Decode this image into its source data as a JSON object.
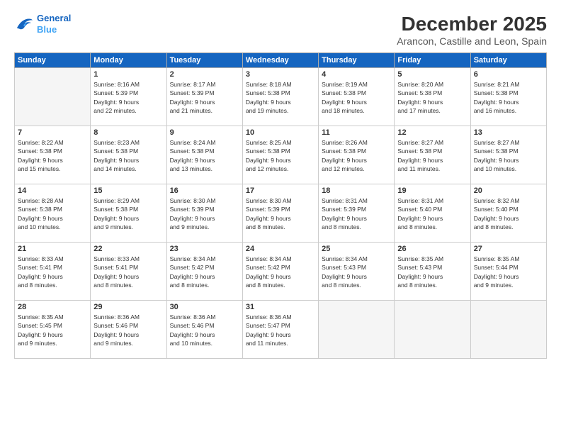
{
  "logo": {
    "line1": "General",
    "line2": "Blue"
  },
  "title": "December 2025",
  "subtitle": "Arancon, Castille and Leon, Spain",
  "days_header": [
    "Sunday",
    "Monday",
    "Tuesday",
    "Wednesday",
    "Thursday",
    "Friday",
    "Saturday"
  ],
  "weeks": [
    [
      {
        "num": "",
        "info": ""
      },
      {
        "num": "1",
        "info": "Sunrise: 8:16 AM\nSunset: 5:39 PM\nDaylight: 9 hours\nand 22 minutes."
      },
      {
        "num": "2",
        "info": "Sunrise: 8:17 AM\nSunset: 5:39 PM\nDaylight: 9 hours\nand 21 minutes."
      },
      {
        "num": "3",
        "info": "Sunrise: 8:18 AM\nSunset: 5:38 PM\nDaylight: 9 hours\nand 19 minutes."
      },
      {
        "num": "4",
        "info": "Sunrise: 8:19 AM\nSunset: 5:38 PM\nDaylight: 9 hours\nand 18 minutes."
      },
      {
        "num": "5",
        "info": "Sunrise: 8:20 AM\nSunset: 5:38 PM\nDaylight: 9 hours\nand 17 minutes."
      },
      {
        "num": "6",
        "info": "Sunrise: 8:21 AM\nSunset: 5:38 PM\nDaylight: 9 hours\nand 16 minutes."
      }
    ],
    [
      {
        "num": "7",
        "info": "Sunrise: 8:22 AM\nSunset: 5:38 PM\nDaylight: 9 hours\nand 15 minutes."
      },
      {
        "num": "8",
        "info": "Sunrise: 8:23 AM\nSunset: 5:38 PM\nDaylight: 9 hours\nand 14 minutes."
      },
      {
        "num": "9",
        "info": "Sunrise: 8:24 AM\nSunset: 5:38 PM\nDaylight: 9 hours\nand 13 minutes."
      },
      {
        "num": "10",
        "info": "Sunrise: 8:25 AM\nSunset: 5:38 PM\nDaylight: 9 hours\nand 12 minutes."
      },
      {
        "num": "11",
        "info": "Sunrise: 8:26 AM\nSunset: 5:38 PM\nDaylight: 9 hours\nand 12 minutes."
      },
      {
        "num": "12",
        "info": "Sunrise: 8:27 AM\nSunset: 5:38 PM\nDaylight: 9 hours\nand 11 minutes."
      },
      {
        "num": "13",
        "info": "Sunrise: 8:27 AM\nSunset: 5:38 PM\nDaylight: 9 hours\nand 10 minutes."
      }
    ],
    [
      {
        "num": "14",
        "info": "Sunrise: 8:28 AM\nSunset: 5:38 PM\nDaylight: 9 hours\nand 10 minutes."
      },
      {
        "num": "15",
        "info": "Sunrise: 8:29 AM\nSunset: 5:38 PM\nDaylight: 9 hours\nand 9 minutes."
      },
      {
        "num": "16",
        "info": "Sunrise: 8:30 AM\nSunset: 5:39 PM\nDaylight: 9 hours\nand 9 minutes."
      },
      {
        "num": "17",
        "info": "Sunrise: 8:30 AM\nSunset: 5:39 PM\nDaylight: 9 hours\nand 8 minutes."
      },
      {
        "num": "18",
        "info": "Sunrise: 8:31 AM\nSunset: 5:39 PM\nDaylight: 9 hours\nand 8 minutes."
      },
      {
        "num": "19",
        "info": "Sunrise: 8:31 AM\nSunset: 5:40 PM\nDaylight: 9 hours\nand 8 minutes."
      },
      {
        "num": "20",
        "info": "Sunrise: 8:32 AM\nSunset: 5:40 PM\nDaylight: 9 hours\nand 8 minutes."
      }
    ],
    [
      {
        "num": "21",
        "info": "Sunrise: 8:33 AM\nSunset: 5:41 PM\nDaylight: 9 hours\nand 8 minutes."
      },
      {
        "num": "22",
        "info": "Sunrise: 8:33 AM\nSunset: 5:41 PM\nDaylight: 9 hours\nand 8 minutes."
      },
      {
        "num": "23",
        "info": "Sunrise: 8:34 AM\nSunset: 5:42 PM\nDaylight: 9 hours\nand 8 minutes."
      },
      {
        "num": "24",
        "info": "Sunrise: 8:34 AM\nSunset: 5:42 PM\nDaylight: 9 hours\nand 8 minutes."
      },
      {
        "num": "25",
        "info": "Sunrise: 8:34 AM\nSunset: 5:43 PM\nDaylight: 9 hours\nand 8 minutes."
      },
      {
        "num": "26",
        "info": "Sunrise: 8:35 AM\nSunset: 5:43 PM\nDaylight: 9 hours\nand 8 minutes."
      },
      {
        "num": "27",
        "info": "Sunrise: 8:35 AM\nSunset: 5:44 PM\nDaylight: 9 hours\nand 9 minutes."
      }
    ],
    [
      {
        "num": "28",
        "info": "Sunrise: 8:35 AM\nSunset: 5:45 PM\nDaylight: 9 hours\nand 9 minutes."
      },
      {
        "num": "29",
        "info": "Sunrise: 8:36 AM\nSunset: 5:46 PM\nDaylight: 9 hours\nand 9 minutes."
      },
      {
        "num": "30",
        "info": "Sunrise: 8:36 AM\nSunset: 5:46 PM\nDaylight: 9 hours\nand 10 minutes."
      },
      {
        "num": "31",
        "info": "Sunrise: 8:36 AM\nSunset: 5:47 PM\nDaylight: 9 hours\nand 11 minutes."
      },
      {
        "num": "",
        "info": ""
      },
      {
        "num": "",
        "info": ""
      },
      {
        "num": "",
        "info": ""
      }
    ]
  ]
}
